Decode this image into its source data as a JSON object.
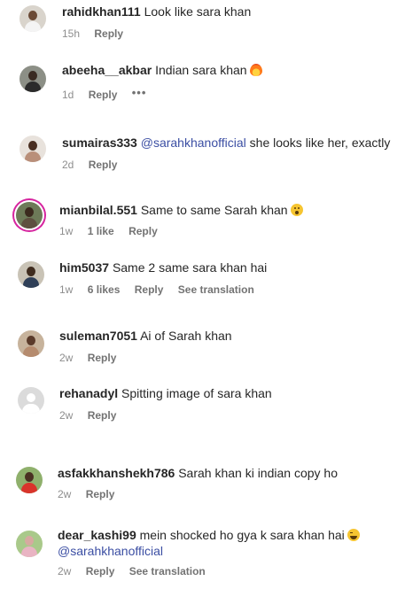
{
  "comments": [
    {
      "username": "rahidkhan111",
      "text": "Look like sara khan",
      "time": "15h",
      "reply": "Reply"
    },
    {
      "username": "abeeha__akbar",
      "text": "Indian sara khan",
      "emoji": "fire-emoji",
      "time": "1d",
      "reply": "Reply",
      "more": "•••"
    },
    {
      "username": "sumairas333",
      "mention": "@sarahkhanofficial",
      "text": "she looks like her, exactly",
      "time": "2d",
      "reply": "Reply"
    },
    {
      "username": "mianbilal.551",
      "text": "Same to same Sarah khan",
      "emoji": "astonished-face-emoji",
      "time": "1w",
      "likes": "1 like",
      "reply": "Reply"
    },
    {
      "username": "him5037",
      "text": "Same 2 same sara khan hai",
      "time": "1w",
      "likes": "6 likes",
      "reply": "Reply",
      "translate": "See translation"
    },
    {
      "username": "suleman7051",
      "text": "Ai of Sarah khan",
      "time": "2w",
      "reply": "Reply"
    },
    {
      "username": "rehanadyl",
      "text": "Spitting image of sara khan",
      "time": "2w",
      "reply": "Reply"
    },
    {
      "username": "asfakkhanshekh786",
      "text": "Sarah khan ki indian copy ho",
      "time": "2w",
      "reply": "Reply"
    },
    {
      "username": "dear_kashi99",
      "text": "mein shocked ho gya k sara khan hai",
      "emoji": "laughing-face-emoji",
      "mention": "@sarahkhanofficial",
      "time": "2w",
      "reply": "Reply",
      "translate": "See translation"
    }
  ],
  "colors": {
    "username": "#262626",
    "meta": "#8e8e8e",
    "mention": "#3b4ea3",
    "story_ring": "#d6249f"
  }
}
